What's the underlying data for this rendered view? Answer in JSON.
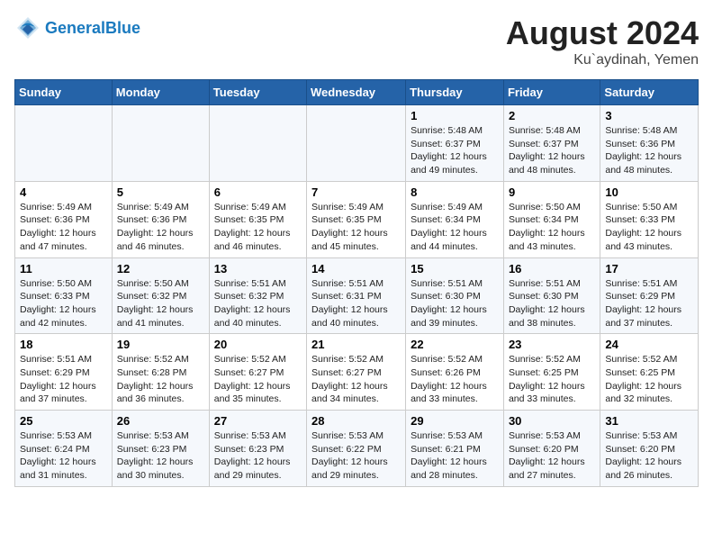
{
  "header": {
    "logo_general": "General",
    "logo_blue": "Blue",
    "month_year": "August 2024",
    "location": "Ku`aydinah, Yemen"
  },
  "days_of_week": [
    "Sunday",
    "Monday",
    "Tuesday",
    "Wednesday",
    "Thursday",
    "Friday",
    "Saturday"
  ],
  "weeks": [
    [
      {
        "day": "",
        "info": ""
      },
      {
        "day": "",
        "info": ""
      },
      {
        "day": "",
        "info": ""
      },
      {
        "day": "",
        "info": ""
      },
      {
        "day": "1",
        "sunrise": "Sunrise: 5:48 AM",
        "sunset": "Sunset: 6:37 PM",
        "daylight": "Daylight: 12 hours and 49 minutes."
      },
      {
        "day": "2",
        "sunrise": "Sunrise: 5:48 AM",
        "sunset": "Sunset: 6:37 PM",
        "daylight": "Daylight: 12 hours and 48 minutes."
      },
      {
        "day": "3",
        "sunrise": "Sunrise: 5:48 AM",
        "sunset": "Sunset: 6:36 PM",
        "daylight": "Daylight: 12 hours and 48 minutes."
      }
    ],
    [
      {
        "day": "4",
        "sunrise": "Sunrise: 5:49 AM",
        "sunset": "Sunset: 6:36 PM",
        "daylight": "Daylight: 12 hours and 47 minutes."
      },
      {
        "day": "5",
        "sunrise": "Sunrise: 5:49 AM",
        "sunset": "Sunset: 6:36 PM",
        "daylight": "Daylight: 12 hours and 46 minutes."
      },
      {
        "day": "6",
        "sunrise": "Sunrise: 5:49 AM",
        "sunset": "Sunset: 6:35 PM",
        "daylight": "Daylight: 12 hours and 46 minutes."
      },
      {
        "day": "7",
        "sunrise": "Sunrise: 5:49 AM",
        "sunset": "Sunset: 6:35 PM",
        "daylight": "Daylight: 12 hours and 45 minutes."
      },
      {
        "day": "8",
        "sunrise": "Sunrise: 5:49 AM",
        "sunset": "Sunset: 6:34 PM",
        "daylight": "Daylight: 12 hours and 44 minutes."
      },
      {
        "day": "9",
        "sunrise": "Sunrise: 5:50 AM",
        "sunset": "Sunset: 6:34 PM",
        "daylight": "Daylight: 12 hours and 43 minutes."
      },
      {
        "day": "10",
        "sunrise": "Sunrise: 5:50 AM",
        "sunset": "Sunset: 6:33 PM",
        "daylight": "Daylight: 12 hours and 43 minutes."
      }
    ],
    [
      {
        "day": "11",
        "sunrise": "Sunrise: 5:50 AM",
        "sunset": "Sunset: 6:33 PM",
        "daylight": "Daylight: 12 hours and 42 minutes."
      },
      {
        "day": "12",
        "sunrise": "Sunrise: 5:50 AM",
        "sunset": "Sunset: 6:32 PM",
        "daylight": "Daylight: 12 hours and 41 minutes."
      },
      {
        "day": "13",
        "sunrise": "Sunrise: 5:51 AM",
        "sunset": "Sunset: 6:32 PM",
        "daylight": "Daylight: 12 hours and 40 minutes."
      },
      {
        "day": "14",
        "sunrise": "Sunrise: 5:51 AM",
        "sunset": "Sunset: 6:31 PM",
        "daylight": "Daylight: 12 hours and 40 minutes."
      },
      {
        "day": "15",
        "sunrise": "Sunrise: 5:51 AM",
        "sunset": "Sunset: 6:30 PM",
        "daylight": "Daylight: 12 hours and 39 minutes."
      },
      {
        "day": "16",
        "sunrise": "Sunrise: 5:51 AM",
        "sunset": "Sunset: 6:30 PM",
        "daylight": "Daylight: 12 hours and 38 minutes."
      },
      {
        "day": "17",
        "sunrise": "Sunrise: 5:51 AM",
        "sunset": "Sunset: 6:29 PM",
        "daylight": "Daylight: 12 hours and 37 minutes."
      }
    ],
    [
      {
        "day": "18",
        "sunrise": "Sunrise: 5:51 AM",
        "sunset": "Sunset: 6:29 PM",
        "daylight": "Daylight: 12 hours and 37 minutes."
      },
      {
        "day": "19",
        "sunrise": "Sunrise: 5:52 AM",
        "sunset": "Sunset: 6:28 PM",
        "daylight": "Daylight: 12 hours and 36 minutes."
      },
      {
        "day": "20",
        "sunrise": "Sunrise: 5:52 AM",
        "sunset": "Sunset: 6:27 PM",
        "daylight": "Daylight: 12 hours and 35 minutes."
      },
      {
        "day": "21",
        "sunrise": "Sunrise: 5:52 AM",
        "sunset": "Sunset: 6:27 PM",
        "daylight": "Daylight: 12 hours and 34 minutes."
      },
      {
        "day": "22",
        "sunrise": "Sunrise: 5:52 AM",
        "sunset": "Sunset: 6:26 PM",
        "daylight": "Daylight: 12 hours and 33 minutes."
      },
      {
        "day": "23",
        "sunrise": "Sunrise: 5:52 AM",
        "sunset": "Sunset: 6:25 PM",
        "daylight": "Daylight: 12 hours and 33 minutes."
      },
      {
        "day": "24",
        "sunrise": "Sunrise: 5:52 AM",
        "sunset": "Sunset: 6:25 PM",
        "daylight": "Daylight: 12 hours and 32 minutes."
      }
    ],
    [
      {
        "day": "25",
        "sunrise": "Sunrise: 5:53 AM",
        "sunset": "Sunset: 6:24 PM",
        "daylight": "Daylight: 12 hours and 31 minutes."
      },
      {
        "day": "26",
        "sunrise": "Sunrise: 5:53 AM",
        "sunset": "Sunset: 6:23 PM",
        "daylight": "Daylight: 12 hours and 30 minutes."
      },
      {
        "day": "27",
        "sunrise": "Sunrise: 5:53 AM",
        "sunset": "Sunset: 6:23 PM",
        "daylight": "Daylight: 12 hours and 29 minutes."
      },
      {
        "day": "28",
        "sunrise": "Sunrise: 5:53 AM",
        "sunset": "Sunset: 6:22 PM",
        "daylight": "Daylight: 12 hours and 29 minutes."
      },
      {
        "day": "29",
        "sunrise": "Sunrise: 5:53 AM",
        "sunset": "Sunset: 6:21 PM",
        "daylight": "Daylight: 12 hours and 28 minutes."
      },
      {
        "day": "30",
        "sunrise": "Sunrise: 5:53 AM",
        "sunset": "Sunset: 6:20 PM",
        "daylight": "Daylight: 12 hours and 27 minutes."
      },
      {
        "day": "31",
        "sunrise": "Sunrise: 5:53 AM",
        "sunset": "Sunset: 6:20 PM",
        "daylight": "Daylight: 12 hours and 26 minutes."
      }
    ]
  ]
}
